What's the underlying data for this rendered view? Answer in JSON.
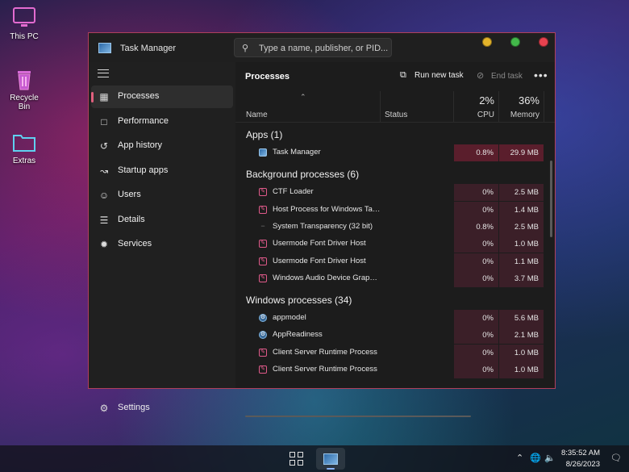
{
  "desktop": {
    "icons": [
      {
        "label": "This PC"
      },
      {
        "label": "Recycle Bin"
      },
      {
        "label": "Extras"
      }
    ]
  },
  "window": {
    "title": "Task Manager",
    "search_placeholder": "Type a name, publisher, or PID...",
    "controls": {
      "minimize_color": "#e3b32a",
      "maximize_color": "#43b84a",
      "close_color": "#e8424f"
    }
  },
  "sidebar": {
    "items": [
      {
        "label": "Processes",
        "icon": "processes-icon",
        "active": true
      },
      {
        "label": "Performance",
        "icon": "performance-icon"
      },
      {
        "label": "App history",
        "icon": "app-history-icon"
      },
      {
        "label": "Startup apps",
        "icon": "startup-apps-icon"
      },
      {
        "label": "Users",
        "icon": "users-icon"
      },
      {
        "label": "Details",
        "icon": "details-icon"
      },
      {
        "label": "Services",
        "icon": "services-icon"
      }
    ],
    "settings_label": "Settings"
  },
  "main": {
    "title": "Processes",
    "run_new_task": "Run new task",
    "end_task": "End task",
    "more": "•••",
    "columns": {
      "name": "Name",
      "status": "Status",
      "cpu_pct": "2%",
      "cpu": "CPU",
      "mem_pct": "36%",
      "memory": "Memory"
    },
    "groups": [
      {
        "label": "Apps (1)",
        "rows": [
          {
            "name": "Task Manager",
            "icon": "task-manager-icon",
            "cpu": "0.8%",
            "mem": "29.9 MB",
            "hi": true
          }
        ]
      },
      {
        "label": "Background processes (6)",
        "rows": [
          {
            "name": "CTF Loader",
            "icon": "edit-icon",
            "cpu": "0%",
            "mem": "2.5 MB"
          },
          {
            "name": "Host Process for Windows Tasks",
            "icon": "edit-icon",
            "cpu": "0%",
            "mem": "1.4 MB"
          },
          {
            "name": "System Transparency (32 bit)",
            "icon": "none-icon",
            "cpu": "0.8%",
            "mem": "2.5 MB"
          },
          {
            "name": "Usermode Font Driver Host",
            "icon": "edit-icon",
            "cpu": "0%",
            "mem": "1.0 MB"
          },
          {
            "name": "Usermode Font Driver Host",
            "icon": "edit-icon",
            "cpu": "0%",
            "mem": "1.1 MB"
          },
          {
            "name": "Windows Audio Device Graph ...",
            "icon": "edit-icon",
            "cpu": "0%",
            "mem": "3.7 MB"
          }
        ]
      },
      {
        "label": "Windows processes (34)",
        "rows": [
          {
            "name": "appmodel",
            "icon": "gear-icon",
            "cpu": "0%",
            "mem": "5.6 MB"
          },
          {
            "name": "AppReadiness",
            "icon": "gear-icon",
            "cpu": "0%",
            "mem": "2.1 MB"
          },
          {
            "name": "Client Server Runtime Process",
            "icon": "edit-icon",
            "cpu": "0%",
            "mem": "1.0 MB"
          },
          {
            "name": "Client Server Runtime Process",
            "icon": "edit-icon",
            "cpu": "0%",
            "mem": "1.0 MB"
          }
        ]
      }
    ]
  },
  "taskbar": {
    "time": "8:35:52 AM",
    "date": "8/26/2023"
  }
}
